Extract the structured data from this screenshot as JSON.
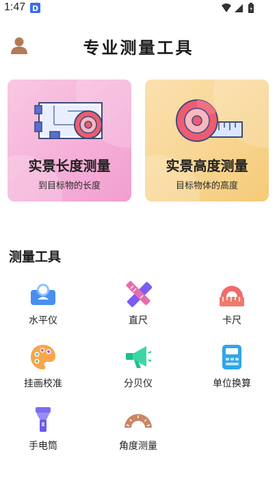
{
  "status_bar": {
    "time": "1:47"
  },
  "header": {
    "title": "专业测量工具",
    "avatar_icon": "user-avatar-icon"
  },
  "cards": [
    {
      "title": "实景长度测量",
      "subtitle": "到目标物的长度",
      "icon": "tape-measure-blueprint-icon",
      "color": "#f5b3d8"
    },
    {
      "title": "实景高度测量",
      "subtitle": "目标物体的高度",
      "icon": "tape-measure-ruler-icon",
      "color": "#f7d68f"
    }
  ],
  "tools_section": {
    "title": "测量工具",
    "items": [
      {
        "label": "水平仪",
        "icon": "level-icon"
      },
      {
        "label": "直尺",
        "icon": "ruler-pencil-icon"
      },
      {
        "label": "卡尺",
        "icon": "protractor-ruler-icon"
      },
      {
        "label": "挂画校准",
        "icon": "palette-icon"
      },
      {
        "label": "分贝仪",
        "icon": "megaphone-icon"
      },
      {
        "label": "单位换算",
        "icon": "calculator-icon"
      },
      {
        "label": "手电筒",
        "icon": "flashlight-icon"
      },
      {
        "label": "角度测量",
        "icon": "protractor-icon"
      }
    ]
  }
}
